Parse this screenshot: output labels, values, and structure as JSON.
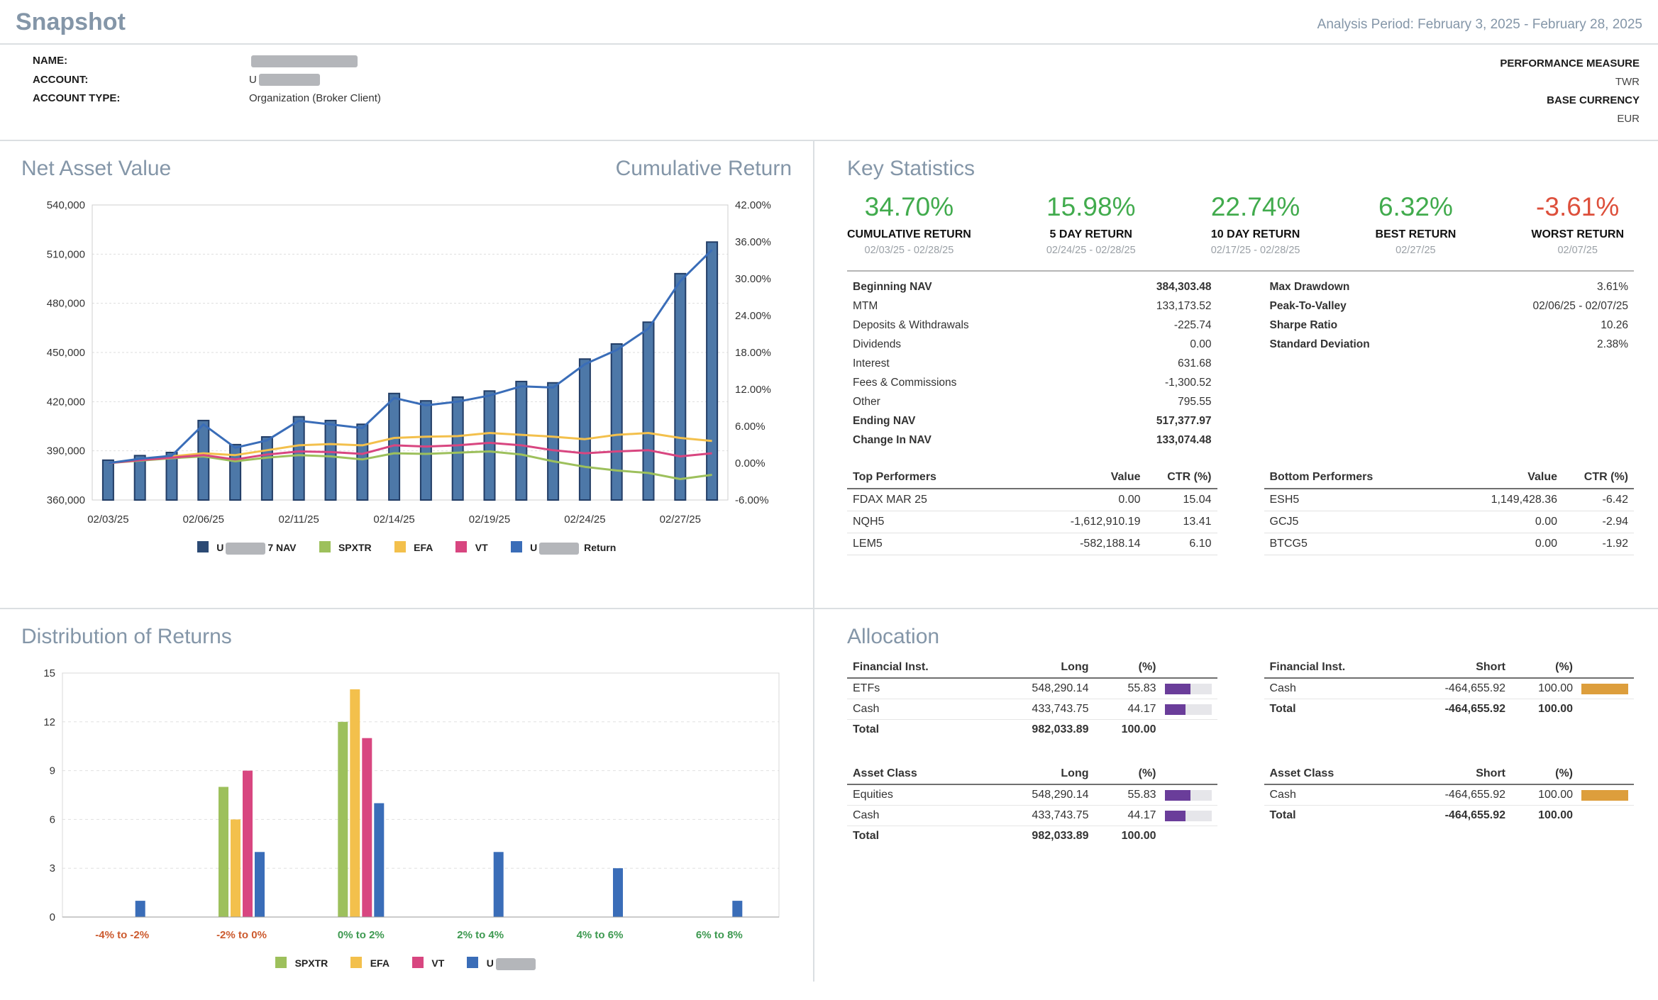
{
  "header": {
    "title": "Snapshot",
    "analysis_period": "Analysis Period: February 3, 2025 - February 28, 2025"
  },
  "account_info": {
    "name_label": "NAME:",
    "account_label": "ACCOUNT:",
    "account_value_prefix": "U",
    "account_type_label": "ACCOUNT TYPE:",
    "account_type_value": "Organization (Broker Client)",
    "performance_measure_label": "PERFORMANCE MEASURE",
    "performance_measure_value": "TWR",
    "base_currency_label": "BASE CURRENCY",
    "base_currency_value": "EUR"
  },
  "nav_section": {
    "title_left": "Net Asset Value",
    "title_right": "Cumulative Return"
  },
  "key_statistics": {
    "title": "Key Statistics",
    "highlights": [
      {
        "value": "34.70%",
        "label": "CUMULATIVE RETURN",
        "period": "02/03/25 - 02/28/25",
        "color": "green"
      },
      {
        "value": "15.98%",
        "label": "5 DAY RETURN",
        "period": "02/24/25 - 02/28/25",
        "color": "green"
      },
      {
        "value": "22.74%",
        "label": "10 DAY RETURN",
        "period": "02/17/25 - 02/28/25",
        "color": "green"
      },
      {
        "value": "6.32%",
        "label": "BEST RETURN",
        "period": "02/27/25",
        "color": "green"
      },
      {
        "value": "-3.61%",
        "label": "WORST RETURN",
        "period": "02/07/25",
        "color": "red"
      }
    ],
    "nav_details": [
      {
        "label": "Beginning NAV",
        "value": "384,303.48",
        "bold": true
      },
      {
        "label": "MTM",
        "value": "133,173.52"
      },
      {
        "label": "Deposits & Withdrawals",
        "value": "-225.74"
      },
      {
        "label": "Dividends",
        "value": "0.00"
      },
      {
        "label": "Interest",
        "value": "631.68"
      },
      {
        "label": "Fees & Commissions",
        "value": "-1,300.52"
      },
      {
        "label": "Other",
        "value": "795.55"
      },
      {
        "label": "Ending NAV",
        "value": "517,377.97",
        "bold": true
      },
      {
        "label": "Change In NAV",
        "value": "133,074.48",
        "bold": true
      }
    ],
    "risk_details": [
      {
        "label": "Max Drawdown",
        "value": "3.61%"
      },
      {
        "label": "Peak-To-Valley",
        "value": "02/06/25 - 02/07/25"
      },
      {
        "label": "Sharpe Ratio",
        "value": "10.26"
      },
      {
        "label": "Standard Deviation",
        "value": "2.38%"
      }
    ],
    "top_performers": {
      "headers": [
        "Top Performers",
        "Value",
        "CTR (%)"
      ],
      "rows": [
        [
          "FDAX MAR 25",
          "0.00",
          "15.04"
        ],
        [
          "NQH5",
          "-1,612,910.19",
          "13.41"
        ],
        [
          "LEM5",
          "-582,188.14",
          "6.10"
        ]
      ]
    },
    "bottom_performers": {
      "headers": [
        "Bottom Performers",
        "Value",
        "CTR (%)"
      ],
      "rows": [
        [
          "ESH5",
          "1,149,428.36",
          "-6.42"
        ],
        [
          "GCJ5",
          "0.00",
          "-2.94"
        ],
        [
          "BTCG5",
          "0.00",
          "-1.92"
        ]
      ]
    }
  },
  "distribution_section": {
    "title": "Distribution of Returns"
  },
  "allocation": {
    "title": "Allocation",
    "tables": [
      {
        "headers": [
          "Financial Inst.",
          "Long",
          "(%)"
        ],
        "bar_color": "#6a3d9a",
        "rows": [
          {
            "label": "ETFs",
            "value": "548,290.14",
            "pct": "55.83",
            "pct_num": 55.83
          },
          {
            "label": "Cash",
            "value": "433,743.75",
            "pct": "44.17",
            "pct_num": 44.17
          }
        ],
        "total": {
          "label": "Total",
          "value": "982,033.89",
          "pct": "100.00"
        }
      },
      {
        "headers": [
          "Financial Inst.",
          "Short",
          "(%)"
        ],
        "bar_color": "#dd9e3c",
        "rows": [
          {
            "label": "Cash",
            "value": "-464,655.92",
            "pct": "100.00",
            "pct_num": 100
          }
        ],
        "total": {
          "label": "Total",
          "value": "-464,655.92",
          "pct": "100.00"
        }
      },
      {
        "headers": [
          "Asset Class",
          "Long",
          "(%)"
        ],
        "bar_color": "#6a3d9a",
        "rows": [
          {
            "label": "Equities",
            "value": "548,290.14",
            "pct": "55.83",
            "pct_num": 55.83
          },
          {
            "label": "Cash",
            "value": "433,743.75",
            "pct": "44.17",
            "pct_num": 44.17
          }
        ],
        "total": {
          "label": "Total",
          "value": "982,033.89",
          "pct": "100.00"
        }
      },
      {
        "headers": [
          "Asset Class",
          "Short",
          "(%)"
        ],
        "bar_color": "#dd9e3c",
        "rows": [
          {
            "label": "Cash",
            "value": "-464,655.92",
            "pct": "100.00",
            "pct_num": 100
          }
        ],
        "total": {
          "label": "Total",
          "value": "-464,655.92",
          "pct": "100.00"
        }
      }
    ]
  },
  "chart_data": [
    {
      "type": "bar+line",
      "title": "Net Asset Value / Cumulative Return",
      "x": [
        "02/03/25",
        "02/04/25",
        "02/05/25",
        "02/06/25",
        "02/07/25",
        "02/10/25",
        "02/11/25",
        "02/12/25",
        "02/13/25",
        "02/14/25",
        "02/17/25",
        "02/18/25",
        "02/19/25",
        "02/20/25",
        "02/21/25",
        "02/24/25",
        "02/25/25",
        "02/26/25",
        "02/27/25",
        "02/28/25"
      ],
      "x_tick_indices": [
        0,
        3,
        6,
        9,
        12,
        15,
        18
      ],
      "x_tick_labels": [
        "02/03/25",
        "02/06/25",
        "02/11/25",
        "02/14/25",
        "02/19/25",
        "02/24/25",
        "02/27/25"
      ],
      "left_axis": {
        "min": 360000,
        "max": 540000,
        "tick_values": [
          360000,
          390000,
          420000,
          450000,
          480000,
          510000,
          540000
        ],
        "tick_labels": [
          "360,000",
          "390,000",
          "420,000",
          "450,000",
          "480,000",
          "510,000",
          "540,000"
        ]
      },
      "right_axis": {
        "min": -6,
        "max": 42,
        "tick_values": [
          -6,
          0,
          6,
          12,
          18,
          24,
          30,
          36,
          42
        ],
        "tick_labels": [
          "-6.00%",
          "0.00%",
          "6.00%",
          "12.00%",
          "18.00%",
          "24.00%",
          "30.00%",
          "36.00%",
          "42.00%"
        ]
      },
      "bar_series": {
        "name": "U***7 NAV",
        "color": "#4d78a8",
        "stroke": "#223d66",
        "values": [
          384303,
          387100,
          389000,
          408500,
          393800,
          398500,
          410800,
          408500,
          406200,
          425000,
          420500,
          422800,
          426500,
          432300,
          431500,
          446000,
          455200,
          468500,
          498100,
          517378
        ]
      },
      "line_series": [
        {
          "name": "SPXTR",
          "color": "#9dc05c",
          "values": [
            0,
            0.4,
            0.8,
            1.1,
            0.3,
            0.9,
            1.3,
            1.1,
            0.6,
            1.6,
            1.5,
            1.7,
            1.9,
            1.4,
            0.3,
            -0.6,
            -1.2,
            -1.6,
            -2.6,
            -1.9
          ]
        },
        {
          "name": "EFA",
          "color": "#f3c04c",
          "values": [
            0,
            0.6,
            1.1,
            1.6,
            1.3,
            2.1,
            2.9,
            3.1,
            2.9,
            4.1,
            4.3,
            4.4,
            4.9,
            4.6,
            4.3,
            3.9,
            4.6,
            4.9,
            4.1,
            3.6
          ]
        },
        {
          "name": "VT",
          "color": "#d84680",
          "values": [
            0,
            0.5,
            0.9,
            1.3,
            0.6,
            1.4,
            1.9,
            1.8,
            1.5,
            2.9,
            2.7,
            2.9,
            3.3,
            2.9,
            2.1,
            1.6,
            1.9,
            2.1,
            1.1,
            1.6
          ]
        },
        {
          "name": "U*** Return",
          "color": "#3a6db8",
          "values": [
            0,
            0.7,
            1.2,
            6.3,
            2.5,
            3.7,
            6.9,
            6.3,
            5.7,
            10.6,
            9.4,
            10,
            11,
            12.5,
            12.3,
            16.1,
            18.4,
            21.9,
            29.6,
            34.7
          ]
        }
      ],
      "legend": [
        {
          "prefix": "U",
          "redacted": true,
          "suffix": "7 NAV",
          "color": "#2c4a74"
        },
        {
          "label": "SPXTR",
          "color": "#9dc05c"
        },
        {
          "label": "EFA",
          "color": "#f3c04c"
        },
        {
          "label": "VT",
          "color": "#d84680"
        },
        {
          "prefix": "U",
          "redacted": true,
          "suffix": " Return",
          "color": "#3a6db8"
        }
      ]
    },
    {
      "type": "bar",
      "title": "Distribution of Returns",
      "categories": [
        "-4% to -2%",
        "-2% to 0%",
        "0% to 2%",
        "2% to 4%",
        "4% to 6%",
        "6% to 8%"
      ],
      "category_colors": [
        "#cc5a2e",
        "#cc5a2e",
        "#3d9950",
        "#3d9950",
        "#3d9950",
        "#3d9950"
      ],
      "series": [
        {
          "name": "SPXTR",
          "color": "#9dc05c",
          "values": [
            0,
            8,
            12,
            0,
            0,
            0
          ]
        },
        {
          "name": "EFA",
          "color": "#f3c04c",
          "values": [
            0,
            6,
            14,
            0,
            0,
            0
          ]
        },
        {
          "name": "VT",
          "color": "#d84680",
          "values": [
            0,
            9,
            11,
            0,
            0,
            0
          ]
        },
        {
          "name": "U***",
          "color": "#3a6db8",
          "values": [
            1,
            4,
            7,
            4,
            3,
            1
          ]
        }
      ],
      "y_axis": {
        "min": 0,
        "max": 15,
        "tick_values": [
          0,
          3,
          6,
          9,
          12,
          15
        ],
        "tick_labels": [
          "0",
          "3",
          "6",
          "9",
          "12",
          "15"
        ]
      },
      "legend": [
        {
          "label": "SPXTR",
          "color": "#9dc05c"
        },
        {
          "label": "EFA",
          "color": "#f3c04c"
        },
        {
          "label": "VT",
          "color": "#d84680"
        },
        {
          "prefix": "U",
          "redacted": true,
          "suffix": "",
          "color": "#3a6db8"
        }
      ]
    }
  ]
}
